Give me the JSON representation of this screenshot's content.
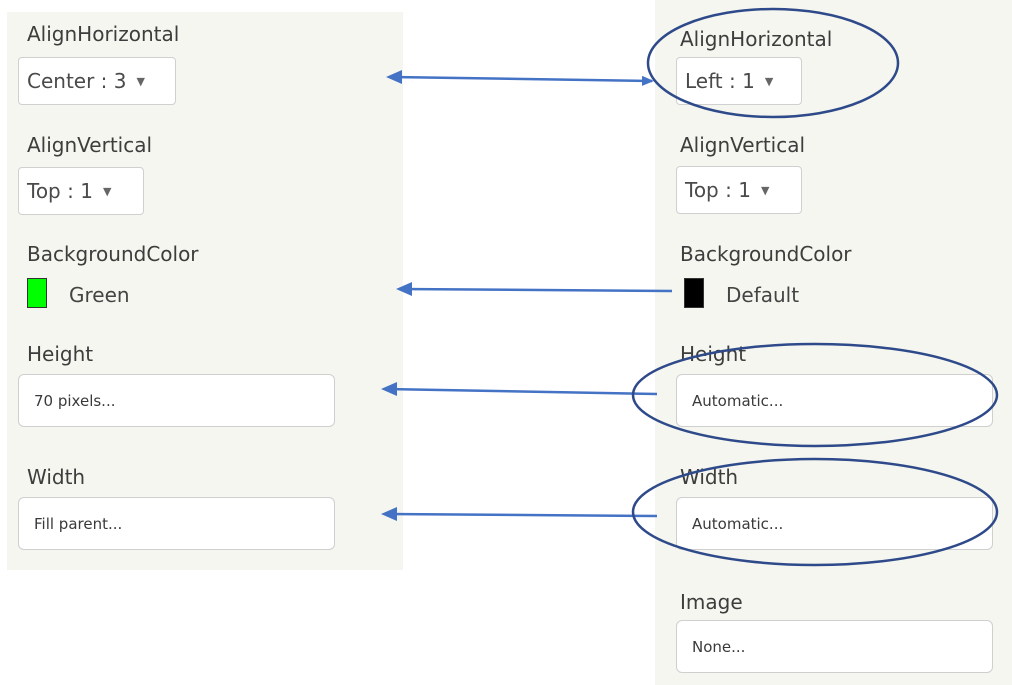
{
  "left_panel": {
    "align_horizontal": {
      "label": "AlignHorizontal",
      "value": "Center : 3"
    },
    "align_vertical": {
      "label": "AlignVertical",
      "value": "Top : 1"
    },
    "background_color": {
      "label": "BackgroundColor",
      "value": "Green",
      "swatch": "#00ff00"
    },
    "height": {
      "label": "Height",
      "value": "70 pixels..."
    },
    "width": {
      "label": "Width",
      "value": "Fill parent..."
    }
  },
  "right_panel": {
    "align_horizontal": {
      "label": "AlignHorizontal",
      "value": "Left : 1"
    },
    "align_vertical": {
      "label": "AlignVertical",
      "value": "Top : 1"
    },
    "background_color": {
      "label": "BackgroundColor",
      "value": "Default",
      "swatch": "#000000"
    },
    "height": {
      "label": "Height",
      "value": "Automatic..."
    },
    "width": {
      "label": "Width",
      "value": "Automatic..."
    },
    "image": {
      "label": "Image",
      "value": "None..."
    }
  },
  "annotation_color": "#2e4a8a",
  "arrow_color": "#4472c4"
}
